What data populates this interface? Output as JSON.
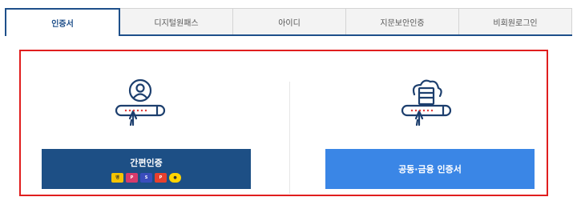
{
  "tabs": [
    {
      "label": "인증서"
    },
    {
      "label": "디지털원패스"
    },
    {
      "label": "아이디"
    },
    {
      "label": "지문보안인증"
    },
    {
      "label": "비회원로그인"
    }
  ],
  "simple_auth": {
    "label": "간편인증"
  },
  "cert_auth": {
    "label": "공동·금융 인증서"
  },
  "colors": {
    "accent": "#1e4f8a",
    "simple_btn": "#1d4f85",
    "cert_btn": "#3a86e6",
    "highlight": "#e01e1e"
  },
  "providers": [
    {
      "name": "kakaobank-icon",
      "color": "#f5c400"
    },
    {
      "name": "pass-icon",
      "color": "#d73a6b"
    },
    {
      "name": "samsungpass-icon",
      "color": "#3a4dbd"
    },
    {
      "name": "payco-icon",
      "color": "#e8402e"
    },
    {
      "name": "kakao-icon",
      "color": "#ffd400"
    }
  ]
}
